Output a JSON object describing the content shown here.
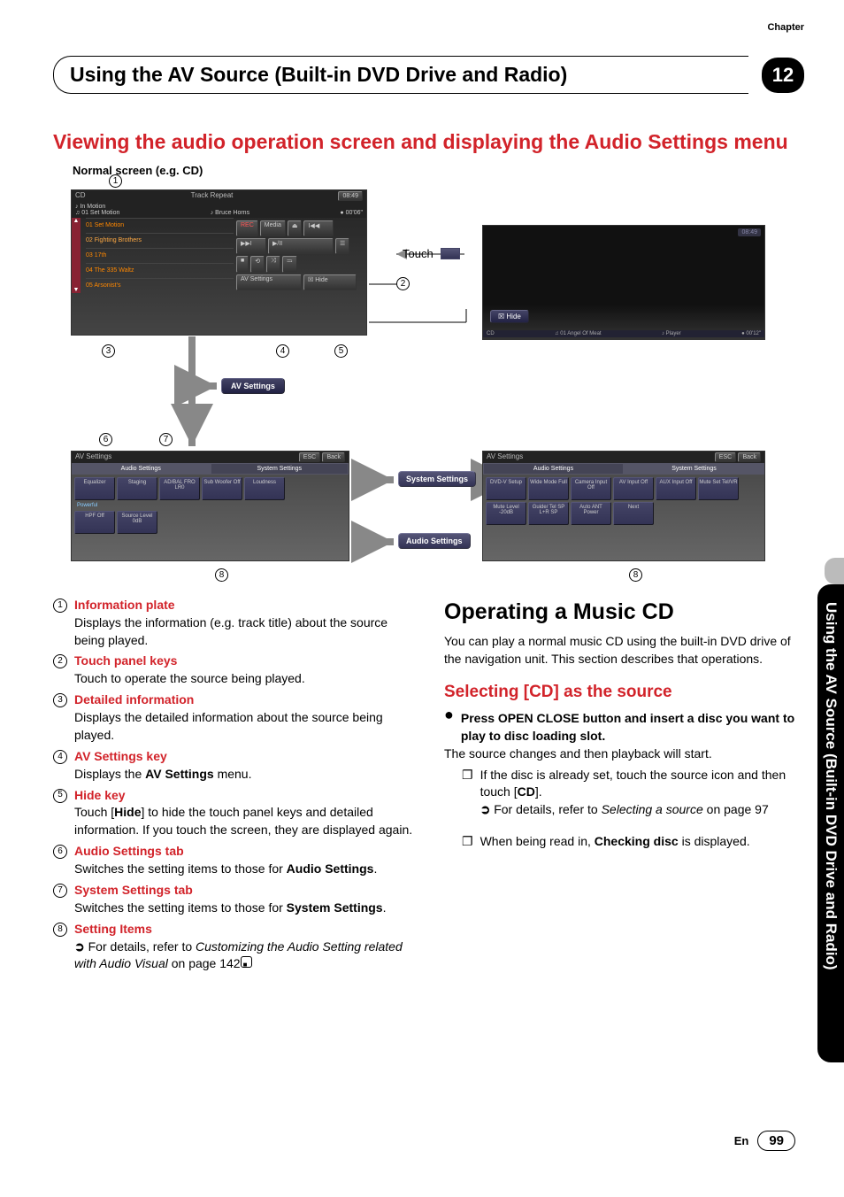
{
  "header": {
    "top_label": "Chapter",
    "title": "Using the AV Source (Built-in DVD Drive and Radio)",
    "chapter_num": "12"
  },
  "section1": {
    "title": "Viewing the audio operation screen and displaying the Audio Settings menu",
    "caption": "Normal screen (e.g. CD)"
  },
  "main_screen": {
    "source": "CD",
    "mode": "Track    Repeat",
    "time": "08:49",
    "album": "In Motion",
    "track_num": "01",
    "track_title": "01 Set Motion",
    "artist": "Bruce Horns",
    "elapsed": "00'06\"",
    "rec": "REC",
    "media": "Media",
    "avs": "AV Settings",
    "hide": "Hide",
    "tracks": [
      "01 Set Motion",
      "02 Fighting Brothers",
      "03 17th",
      "04 The 335 Waltz",
      "05 Arsonist's"
    ]
  },
  "dark_screen": {
    "time": "08:49",
    "source": "CD",
    "track": "01 Angel Of Meat",
    "artist": "Player",
    "elapsed": "00'12\"",
    "hide": "Hide"
  },
  "av_settings_button": "AV Settings",
  "system_settings_button": "System Settings",
  "audio_settings_button": "Audio Settings",
  "touch_label": "Touch",
  "aset": {
    "title": "AV Settings",
    "esc": "ESC",
    "back": "Back",
    "tab1": "Audio Settings",
    "tab2": "System Settings",
    "items": [
      "Equalizer",
      "Staging",
      "AD/BAL FRO LR0",
      "Sub Woofer Off",
      "Loudness",
      "HPF Off",
      "Source Level 0dB"
    ],
    "preset": "Powerful"
  },
  "sset": {
    "title": "AV Settings",
    "esc": "ESC",
    "back": "Back",
    "tab1": "Audio Settings",
    "tab2": "System Settings",
    "items": [
      "DVD-V Setup",
      "Wide Mode Full",
      "Camera Input Off",
      "AV Input Off",
      "AUX Input Off",
      "Mute Set Tel/VR",
      "Mute Level -20dB",
      "Guide/ Tel SP L+R SP",
      "Auto ANT Power",
      "Next"
    ]
  },
  "callouts": {
    "1": "1",
    "2": "2",
    "3": "3",
    "4": "4",
    "5": "5",
    "6": "6",
    "7": "7",
    "8": "8"
  },
  "list": {
    "1": {
      "title": "Information plate",
      "body": "Displays the information (e.g. track title) about the source being played."
    },
    "2": {
      "title": "Touch panel keys",
      "body": "Touch to operate the source being played."
    },
    "3": {
      "title": "Detailed information",
      "body": "Displays the detailed information about the source being played."
    },
    "4": {
      "title": "AV Settings key",
      "body_pre": "Displays the ",
      "body_bold": "AV Settings",
      "body_post": " menu."
    },
    "5": {
      "title": "Hide key",
      "body_pre": "Touch [",
      "body_bold": "Hide",
      "body_post": "] to hide the touch panel keys and detailed information. If you touch the screen, they are displayed again."
    },
    "6": {
      "title": "Audio Settings tab",
      "body_pre": "Switches the setting items to those for ",
      "body_bold": "Audio Settings",
      "body_post": "."
    },
    "7": {
      "title": "System Settings tab",
      "body_pre": "Switches the setting items to those for ",
      "body_bold": "System Settings",
      "body_post": "."
    },
    "8": {
      "title": "Setting Items",
      "ref_pre": "For details, refer to ",
      "ref_italic": "Customizing the Audio Setting related with Audio Visual",
      "ref_post": " on page 142"
    }
  },
  "col2": {
    "h2": "Operating a Music CD",
    "intro": "You can play a normal music CD using the built-in DVD drive of the navigation unit. This section describes that operations.",
    "sub_title": "Selecting [CD] as the source",
    "step_bold": "Press OPEN CLOSE button and insert a disc you want to play to disc loading slot.",
    "step_body": "The source changes and then playback will start.",
    "note1_pre": "If the disc is already set, touch the source icon and then touch [",
    "note1_bold": "CD",
    "note1_post": "].",
    "ref_pre": "For details, refer to ",
    "ref_italic": "Selecting a source",
    "ref_post": " on page 97",
    "note2_pre": "When being read in, ",
    "note2_bold": "Checking disc",
    "note2_post": " is displayed."
  },
  "side_tab": "Using the AV Source (Built-in DVD Drive and Radio)",
  "footer": {
    "lang": "En",
    "page": "99"
  }
}
